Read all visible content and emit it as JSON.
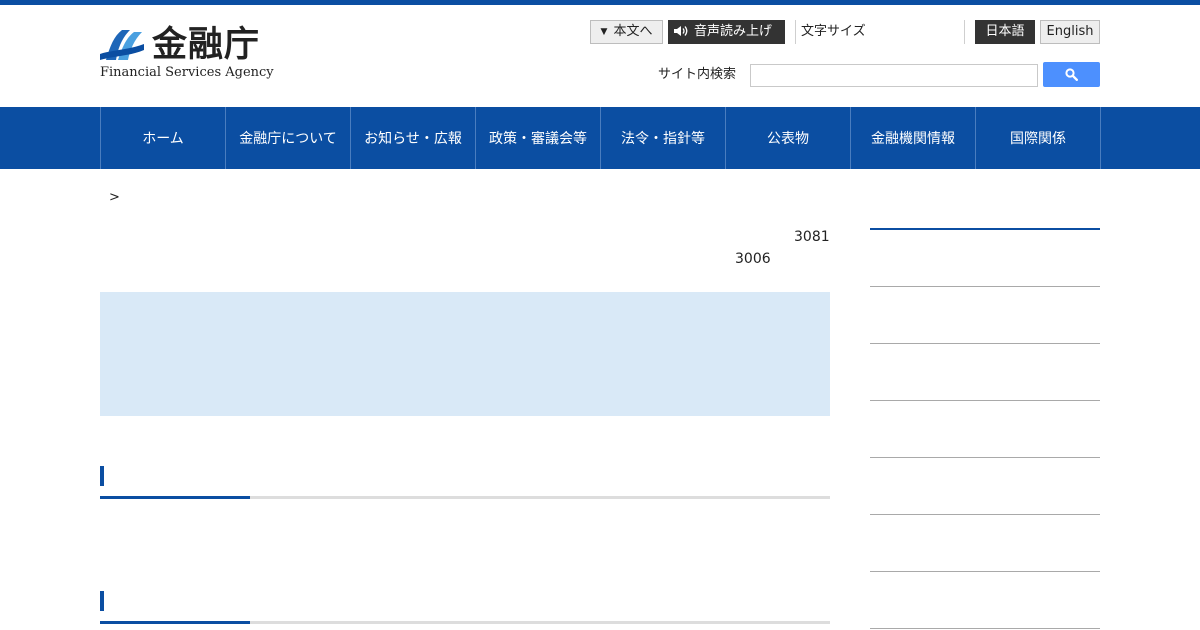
{
  "header": {
    "logo_jp": "金融庁",
    "logo_en": "Financial Services Agency",
    "skip_to_content": "本文へ",
    "read_aloud": "音声読み上げ",
    "font_size": "文字サイズ",
    "lang_ja": "日本語",
    "lang_en": "English",
    "search_label": "サイト内検索",
    "search_placeholder": "",
    "search_value": ""
  },
  "nav": {
    "items": [
      "ホーム",
      "金融庁について",
      "お知らせ・広報",
      "政策・審議会等",
      "法令・指針等",
      "公表物",
      "金融機関情報",
      "国際関係"
    ]
  },
  "content": {
    "breadcrumb_sep": ">",
    "number_1": "3081",
    "number_2": "3006"
  },
  "colors": {
    "brand_blue": "#0b4ea2",
    "notice_bg": "#d9e9f7",
    "search_button": "#4d90fe"
  },
  "icons": {
    "skip": "triangle-down-icon",
    "voice": "speaker-icon",
    "search": "magnifier-icon",
    "logo": "fsa-logo-mark-icon"
  }
}
